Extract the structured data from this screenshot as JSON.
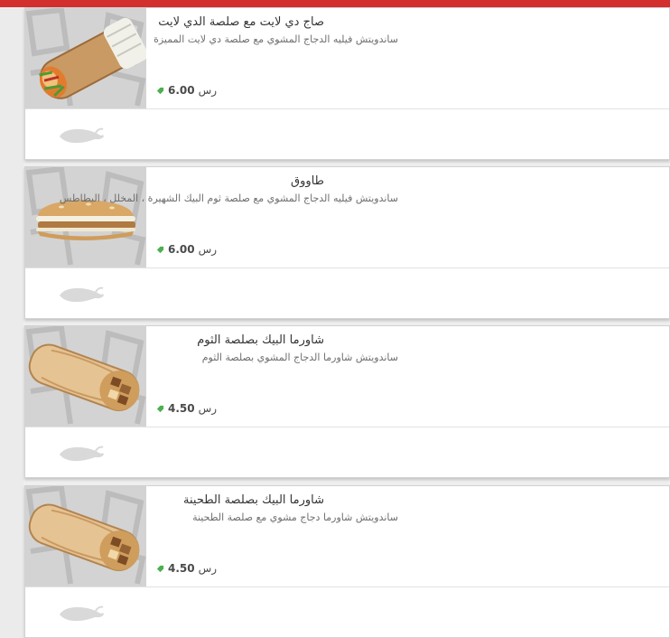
{
  "menu": {
    "items": [
      {
        "name": "صاج دي لايت مع صلصة الدي لايت",
        "description": "ساندويتش فيليه الدجاج المشوي مع صلصة دي لايت المميزة",
        "price": "6.00",
        "currency": "رس",
        "image_icon": "wrap-sandwich-image",
        "spicy_icon": "chili-pepper-icon"
      },
      {
        "name": "طاووق",
        "description": "ساندويتش فيليه الدجاج المشوي مع صلصة ثوم البيك الشهيرة ، المخلل ، البطاطس",
        "price": "6.00",
        "currency": "رس",
        "image_icon": "burger-sandwich-image",
        "spicy_icon": "chili-pepper-icon"
      },
      {
        "name": "شاورما البيك بصلصة الثوم",
        "description": "ساندويتش شاورما الدجاج المشوي بصلصة الثوم",
        "price": "4.50",
        "currency": "رس",
        "image_icon": "shawarma-wrap-image",
        "spicy_icon": "chili-pepper-icon"
      },
      {
        "name": "شاورما البيك بصلصة الطحينة",
        "description": "ساندويتش شاورما دجاج مشوي مع صلصة الطحينة",
        "price": "4.50",
        "currency": "رس",
        "image_icon": "shawarma-wrap-image",
        "spicy_icon": "chili-pepper-icon"
      }
    ]
  },
  "colors": {
    "header_red": "#d32f2f",
    "price_tag_green": "#4caf50",
    "chili_gray": "#d9d9d9"
  }
}
